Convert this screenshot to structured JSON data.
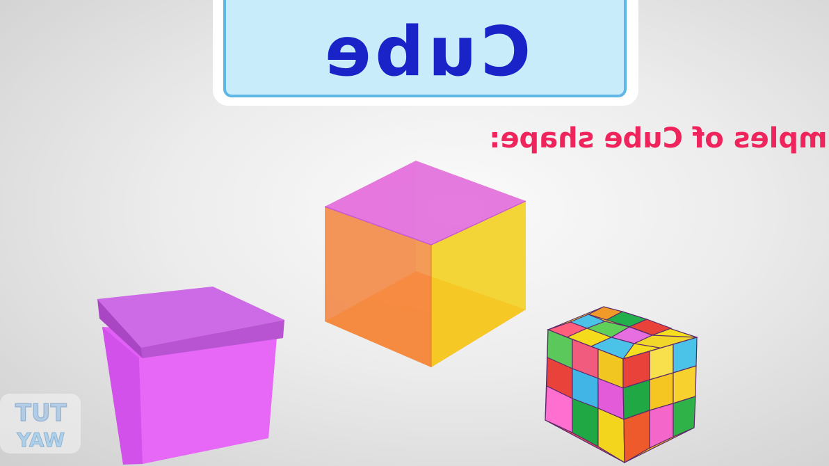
{
  "title": "Cube",
  "subtitle": "amples of Cube shape:",
  "watermark": {
    "line1": "TUT",
    "line2": "WAY"
  },
  "colors": {
    "title_text": "#1a23c8",
    "title_box_fill": "#c9ecfa",
    "title_box_border": "#5fb7e6",
    "subtitle_text": "#f0245c",
    "gift_box": "#e05ff5",
    "gift_lid": "#d45cf0"
  },
  "objects": [
    {
      "name": "gift-box"
    },
    {
      "name": "transparent-cube"
    },
    {
      "name": "rubiks-cube"
    }
  ]
}
